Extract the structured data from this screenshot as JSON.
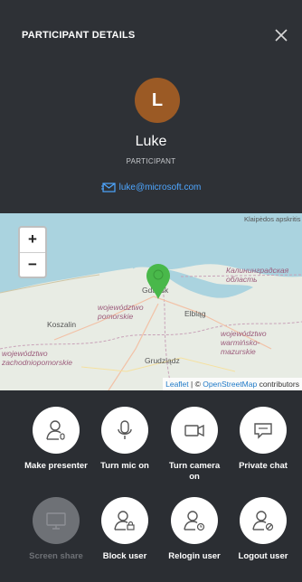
{
  "header": {
    "title": "PARTICIPANT DETAILS"
  },
  "participant": {
    "initial": "L",
    "name": "Luke",
    "role": "PARTICIPANT",
    "email": "luke@microsoft.com",
    "avatar_color": "#9b5a25"
  },
  "map": {
    "zoom_in": "+",
    "zoom_out": "−",
    "labels": {
      "kaliningrad": "Калининградская область",
      "gdansk": "Gdańsk",
      "pomorskie": "województwo pomorskie",
      "koszalin": "Koszalin",
      "elblag": "Elbląg",
      "zachodniopomorskie": "województwo zachodniopomorskie",
      "grudziadz": "Grudziądz",
      "warminsko": "województwo warmińsko-mazurskie",
      "klaipedos": "Klaipėdos apskritis"
    },
    "attribution": {
      "leaflet": "Leaflet",
      "separator": " | © ",
      "osm": "OpenStreetMap",
      "suffix": " contributors"
    },
    "marker_color": "#49b84a"
  },
  "actions": [
    {
      "label": "Make presenter",
      "icon": "user-presenter-icon",
      "enabled": true
    },
    {
      "label": "Turn mic on",
      "icon": "microphone-icon",
      "enabled": true
    },
    {
      "label": "Turn camera on",
      "icon": "camera-icon",
      "enabled": true
    },
    {
      "label": "Private chat",
      "icon": "chat-icon",
      "enabled": true
    },
    {
      "label": "Screen share",
      "icon": "screen-share-icon",
      "enabled": false
    },
    {
      "label": "Block user",
      "icon": "user-block-icon",
      "enabled": true
    },
    {
      "label": "Relogin user",
      "icon": "user-relogin-icon",
      "enabled": true
    },
    {
      "label": "Logout user",
      "icon": "user-logout-icon",
      "enabled": true
    }
  ]
}
